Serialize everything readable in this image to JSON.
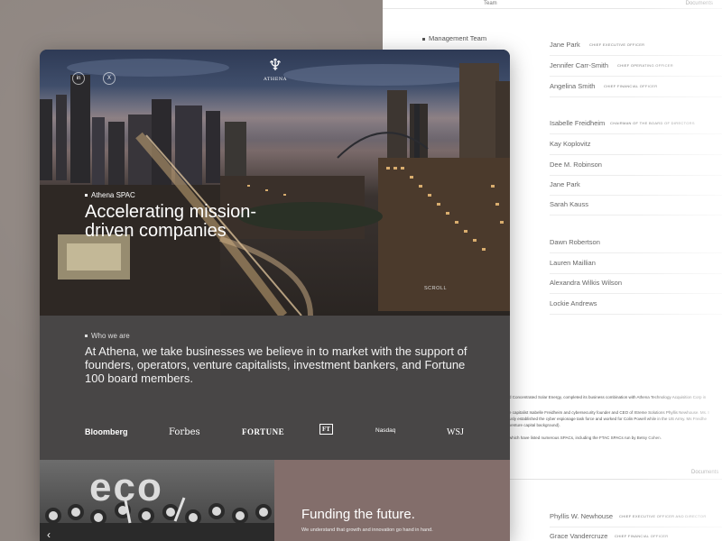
{
  "back": {
    "topbar": {
      "team": "Team",
      "documents": "Documents"
    },
    "section_label": "Management Team",
    "management": [
      {
        "name": "Jane Park",
        "title": "CHIEF EXECUTIVE OFFICER"
      },
      {
        "name": "Jennifer Carr-Smith",
        "title": "CHIEF OPERATING OFFICER"
      },
      {
        "name": "Angelina Smith",
        "title": "CHIEF FINANCIAL OFFICER"
      }
    ],
    "board": [
      {
        "name": "Isabelle Freidheim",
        "title": "CHAIRMAN OF THE BOARD OF DIRECTORS"
      },
      {
        "name": "Kay Koplovitz",
        "title": ""
      },
      {
        "name": "Dee M. Robinson",
        "title": ""
      },
      {
        "name": "Jane Park",
        "title": ""
      },
      {
        "name": "Sarah Kauss",
        "title": ""
      }
    ],
    "advisors": [
      {
        "name": "Dawn Robertson",
        "title": ""
      },
      {
        "name": "Lauren Maillian",
        "title": ""
      },
      {
        "name": "Alexandra Wilkis Wilson",
        "title": ""
      },
      {
        "name": "Lockie Andrews",
        "title": ""
      }
    ],
    "text_lines": [
      "d Concentrated Solar Energy, completed its business combination with Athena Technology Acquisition Corp in",
      "e capitalist Isabelle Freidheim and cybersecurity founder and CEO of Xtreme Solutions Phyllis Newhouse. Ms. I",
      "usly established the cyber espionage task force and worked for Colin Powell while in the US Army. Ms Freidhe",
      "venture capital background).",
      "which have listed numerous SPACs, including the FTAC SPACs run by Betsy Cohen."
    ],
    "documents2": "Documents",
    "officers": [
      {
        "name": "Phyllis W. Newhouse",
        "title": "CHIEF EXECUTIVE OFFICER AND DIRECTOR"
      },
      {
        "name": "Grace Vandercruze",
        "title": "CHIEF FINANCIAL OFFICER"
      }
    ]
  },
  "front": {
    "social": [
      "in",
      "X"
    ],
    "logo_word": "ATHENA",
    "eyebrow": "Athena SPAC",
    "title": "Accelerating mission-driven companies",
    "scroll": "SCROLL",
    "who_eyebrow": "Who we are",
    "who_body": "At Athena, we take businesses we believe in to market with the support of founders, operators, venture capitalists, investment bankers, and Fortune 100 board members.",
    "press": [
      "Bloomberg",
      "Forbes",
      "FORTUNE",
      "FT",
      "Nasdaq",
      "WSJ"
    ],
    "eco_text": "eco",
    "funding_title": "Funding the future.",
    "funding_sub": "We understand that growth and innovation go hand in hand."
  }
}
